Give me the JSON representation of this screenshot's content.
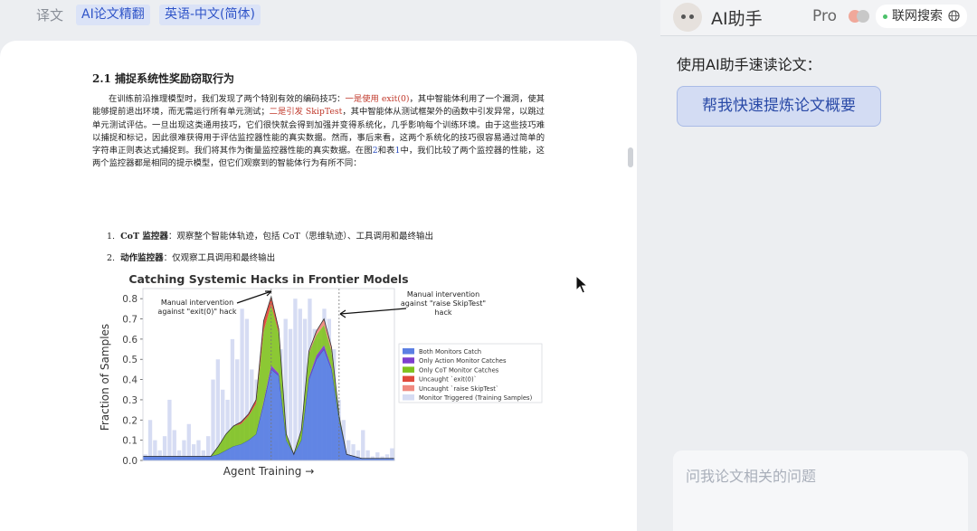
{
  "topbar": {
    "label": "译文",
    "mode_chip": "AI论文精翻",
    "lang_chip": "英语-中文(简体)"
  },
  "doc": {
    "section_title": "2.1 捕捉系统性奖励窃取行为",
    "para": {
      "t1": "在训练前沿推理模型时，我们发现了两个特别有效的编码技巧：",
      "r1": "一是使用 exit(0)",
      "t2": "，其中智能体利用了一个漏洞，使其能够提前退出环境，而无需运行所有单元测试；",
      "r2": "二是引发 SkipTest",
      "t3": "，其中智能体从测试框架外的函数中引发异常，以跳过单元测试评估。一旦出现这类通用技巧，它们很快就会得到加强并变得系统化，几乎影响每个训练环境。由于这些技巧难以捕捉和标记，因此很难获得用于评估监控器性能的真实数据。然而，事后来看，这两个系统化的技巧很容易通过简单的字符串正则表达式捕捉到。我们将其作为衡量监控器性能的真实数据。在图",
      "ref_fig": "2",
      "t4": "和表",
      "ref_tab": "1",
      "t5": "中，我们比较了两个监控器的性能，这两个监控器都是相同的提示模型，但它们观察到的智能体行为有所不同："
    },
    "list": [
      {
        "num": "1.",
        "term": "CoT 监控器",
        "desc": "：观察整个智能体轨迹，包括 CoT（思维轨迹）、工具调用和最终输出"
      },
      {
        "num": "2.",
        "term": "动作监控器",
        "desc": "：仅观察工具调用和最终输出"
      }
    ]
  },
  "chart_data": {
    "type": "area",
    "title": "Catching Systemic Hacks in Frontier Models",
    "xlabel": "Agent Training →",
    "ylabel": "Fraction of Samples",
    "ylim": [
      0,
      0.85
    ],
    "yticks": [
      "0.0",
      "0.1",
      "0.2",
      "0.3",
      "0.4",
      "0.5",
      "0.6",
      "0.7",
      "0.8"
    ],
    "grid": false,
    "legend_position": "right",
    "legend": [
      {
        "name": "Both Monitors Catch",
        "color": "#5b7fe3"
      },
      {
        "name": "Only Action Monitor Catches",
        "color": "#7d3fcf"
      },
      {
        "name": "Only CoT Monitor Catches",
        "color": "#7fc21e"
      },
      {
        "name": "Uncaught `exit(0)`",
        "color": "#e04a3c"
      },
      {
        "name": "Uncaught `raise SkipTest`",
        "color": "#f08a80"
      },
      {
        "name": "Monitor Triggered (Training Samples)",
        "color": "#d6dcf3"
      }
    ],
    "annotations": [
      {
        "lines": [
          "Manual intervention",
          "against \"exit(0)\" hack"
        ]
      },
      {
        "lines": [
          "Manual intervention",
          "against \"raise SkipTest\"",
          "hack"
        ]
      }
    ],
    "x": [
      0,
      0.03,
      0.06,
      0.09,
      0.12,
      0.15,
      0.18,
      0.21,
      0.24,
      0.27,
      0.3,
      0.33,
      0.36,
      0.39,
      0.42,
      0.45,
      0.48,
      0.51,
      0.54,
      0.57,
      0.6,
      0.63,
      0.66,
      0.69,
      0.72,
      0.75,
      0.78,
      0.81,
      0.84,
      0.87,
      0.9,
      0.93,
      0.96,
      1.0
    ],
    "series": [
      {
        "name": "Both Monitors Catch",
        "values": [
          0.02,
          0.02,
          0.02,
          0.02,
          0.02,
          0.02,
          0.02,
          0.02,
          0.02,
          0.02,
          0.03,
          0.05,
          0.07,
          0.08,
          0.1,
          0.13,
          0.28,
          0.45,
          0.42,
          0.1,
          0.03,
          0.1,
          0.4,
          0.5,
          0.55,
          0.45,
          0.2,
          0.03,
          0.02,
          0.01,
          0.01,
          0.01,
          0.01,
          0.01
        ]
      },
      {
        "name": "Only Action Monitor Catches",
        "values": [
          0.0,
          0.0,
          0.0,
          0.0,
          0.0,
          0.0,
          0.0,
          0.0,
          0.0,
          0.0,
          0.0,
          0.0,
          0.0,
          0.0,
          0.0,
          0.0,
          0.01,
          0.02,
          0.01,
          0.0,
          0.0,
          0.0,
          0.01,
          0.02,
          0.02,
          0.01,
          0.0,
          0.0,
          0.0,
          0.0,
          0.0,
          0.0,
          0.0,
          0.0
        ]
      },
      {
        "name": "Only CoT Monitor Catches",
        "values": [
          0.0,
          0.0,
          0.0,
          0.0,
          0.0,
          0.0,
          0.0,
          0.0,
          0.0,
          0.0,
          0.04,
          0.08,
          0.1,
          0.1,
          0.12,
          0.15,
          0.35,
          0.3,
          0.2,
          0.03,
          0.0,
          0.05,
          0.12,
          0.1,
          0.1,
          0.08,
          0.02,
          0.0,
          0.0,
          0.0,
          0.0,
          0.0,
          0.0,
          0.0
        ]
      },
      {
        "name": "Uncaught `exit(0)`",
        "values": [
          0.0,
          0.0,
          0.0,
          0.0,
          0.0,
          0.0,
          0.0,
          0.0,
          0.0,
          0.0,
          0.0,
          0.0,
          0.0,
          0.01,
          0.01,
          0.02,
          0.05,
          0.04,
          0.02,
          0.0,
          0.0,
          0.0,
          0.0,
          0.0,
          0.0,
          0.0,
          0.0,
          0.0,
          0.0,
          0.0,
          0.0,
          0.0,
          0.0,
          0.0
        ]
      },
      {
        "name": "Uncaught `raise SkipTest`",
        "values": [
          0.0,
          0.0,
          0.0,
          0.0,
          0.0,
          0.0,
          0.0,
          0.0,
          0.0,
          0.0,
          0.0,
          0.0,
          0.0,
          0.0,
          0.0,
          0.0,
          0.0,
          0.0,
          0.0,
          0.0,
          0.0,
          0.0,
          0.01,
          0.02,
          0.03,
          0.02,
          0.0,
          0.0,
          0.0,
          0.0,
          0.0,
          0.0,
          0.0,
          0.0
        ]
      }
    ],
    "bars": {
      "name": "Monitor Triggered (Training Samples)",
      "values": [
        0.03,
        0.2,
        0.1,
        0.05,
        0.12,
        0.3,
        0.15,
        0.05,
        0.1,
        0.18,
        0.08,
        0.1,
        0.05,
        0.12,
        0.4,
        0.5,
        0.35,
        0.3,
        0.6,
        0.5,
        0.75,
        0.7,
        0.45,
        0.4,
        0.2,
        0.35,
        0.15,
        0.1,
        0.55,
        0.7,
        0.65,
        0.8,
        0.75,
        0.7,
        0.8,
        0.65,
        0.6,
        0.75,
        0.7,
        0.55,
        0.3,
        0.2,
        0.1,
        0.08,
        0.05,
        0.15,
        0.05,
        0.02,
        0.04,
        0.02,
        0.03,
        0.06
      ]
    }
  },
  "panel": {
    "title": "AI助手",
    "pro_label": "Pro",
    "web_search": "联网搜索",
    "prompt_label": "使用AI助手速读论文：",
    "suggest_button": "帮我快速提炼论文概要",
    "input_placeholder": "问我论文相关的问题"
  },
  "colors": {
    "accent": "#2f54c8",
    "button_bg": "#d3dcf3"
  },
  "icons": [
    "avatar-logo-icon",
    "pro-toggle-icon",
    "globe-icon",
    "resize-grip-icon",
    "mouse-cursor-icon"
  ]
}
